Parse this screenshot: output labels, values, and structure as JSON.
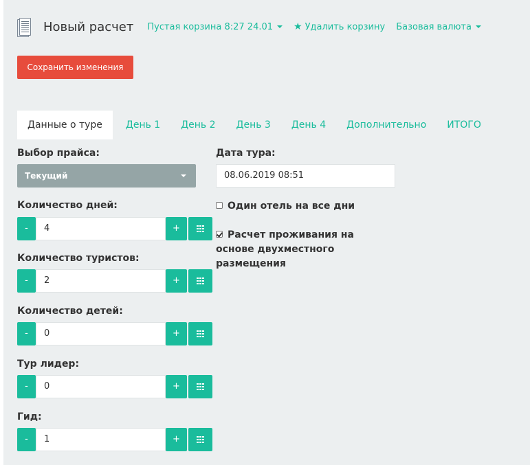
{
  "header": {
    "title": "Новый расчет",
    "icon": "document-icon",
    "basket_label": "Пустая корзина 8:27 24.01",
    "delete_basket_label": "Удалить корзину",
    "currency_label": "Базовая валюта"
  },
  "toolbar": {
    "save_label": "Сохранить изменения"
  },
  "tabs": [
    {
      "label": "Данные о туре",
      "active": true
    },
    {
      "label": "День 1"
    },
    {
      "label": "День 2"
    },
    {
      "label": "День 3"
    },
    {
      "label": "День 4"
    },
    {
      "label": "Дополнительно"
    },
    {
      "label": "ИТОГО"
    }
  ],
  "form": {
    "price_label": "Выбор прайса:",
    "price_value": "Текущий",
    "days_label": "Количество дней:",
    "days_value": "4",
    "tourists_label": "Количество туристов:",
    "tourists_value": "2",
    "children_label": "Количество детей:",
    "children_value": "0",
    "leader_label": "Тур лидер:",
    "leader_value": "0",
    "guide_label": "Гид:",
    "guide_value": "1",
    "minus_label": "-",
    "plus_label": "+",
    "date_label": "Дата тура:",
    "date_value": "08.06.2019 08:51",
    "one_hotel_label": "Один отель на все дни",
    "one_hotel_checked": false,
    "double_label_1": "Расчет проживания на",
    "double_label_2": "основе двухместного",
    "double_label_3": "размещения",
    "double_checked": true
  },
  "colors": {
    "accent": "#1abc9c",
    "danger": "#e74c3c",
    "select_bg": "#95a5a6",
    "page_bg": "#eceff0"
  }
}
